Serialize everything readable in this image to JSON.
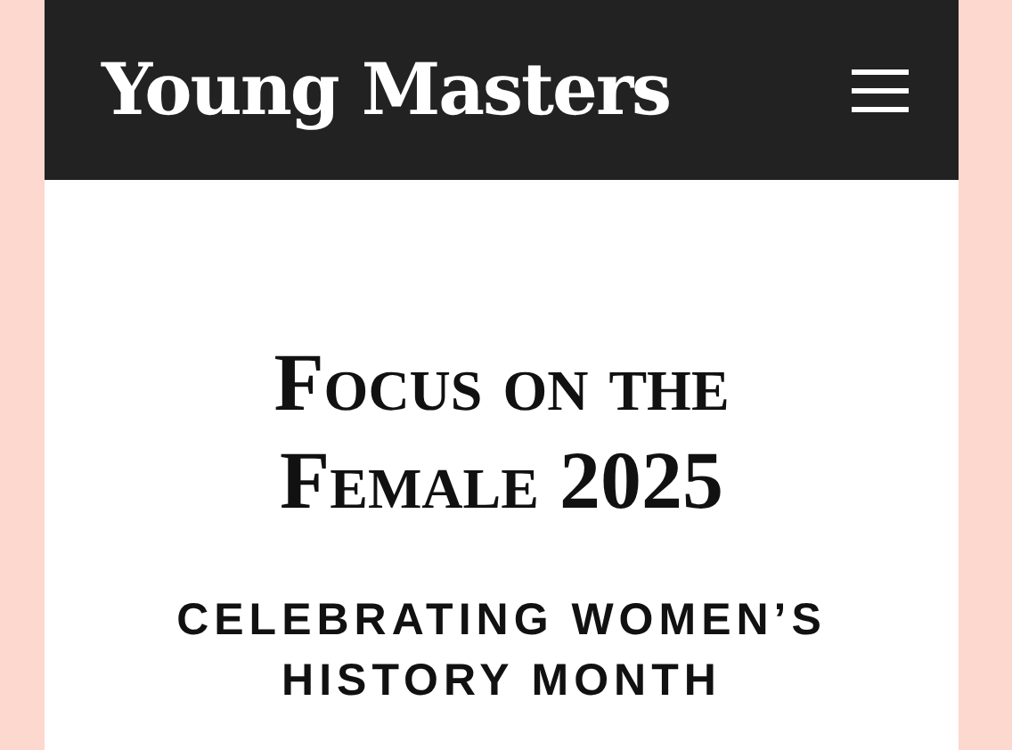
{
  "header": {
    "logo": "Young Masters"
  },
  "title": "Focus on the Female 2025",
  "subtitle": "CELEBRATING WOMEN’S HISTORY MONTH"
}
